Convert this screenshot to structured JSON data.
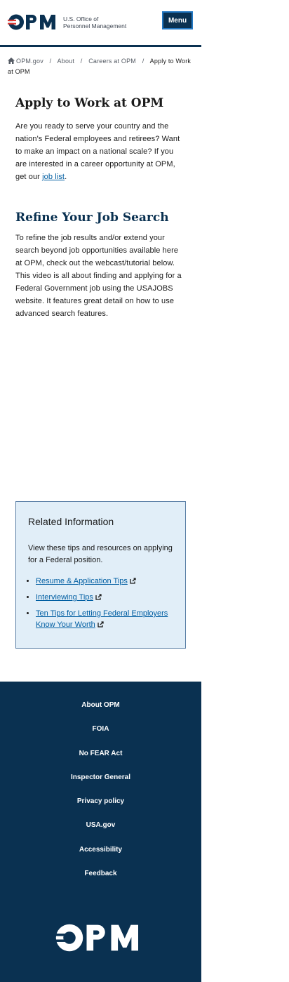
{
  "header": {
    "logo_text": "OPM",
    "agency_line1": "U.S. Office of",
    "agency_line2": "Personnel Management",
    "menu_label": "Menu"
  },
  "breadcrumb": {
    "home": "OPM.gov",
    "items": [
      "About",
      "Careers at OPM"
    ],
    "current": "Apply to Work at OPM"
  },
  "main": {
    "title": "Apply to Work at OPM",
    "intro": "Are you ready to serve your country and the nation's Federal employees and retirees? Want to make an impact on a national scale? If you are interested in a career opportunity at OPM, get our ",
    "intro_link": "job list",
    "intro_end": ".",
    "refine_heading": "Refine Your Job Search",
    "refine_text": "To refine the job results and/or extend your search beyond job opportunities available here at OPM, check out the webcast/tutorial below. This video is all about finding and applying for a Federal Government job using the USAJOBS website. It features great detail on how to use advanced search features."
  },
  "related": {
    "heading": "Related Information",
    "text": "View these tips and resources on applying for a Federal position.",
    "links": [
      "Resume & Application Tips",
      "Interviewing Tips",
      "Ten Tips for Letting Federal Employers Know Your Worth"
    ]
  },
  "footer": {
    "links": [
      "About OPM",
      "FOIA",
      "No FEAR Act",
      "Inspector General",
      "Privacy policy",
      "USA.gov",
      "Accessibility",
      "Feedback"
    ],
    "logo_text": "OPM"
  },
  "colors": {
    "navy": "#0a3151",
    "link": "#005ea2",
    "related_bg": "#e1eef8",
    "logo_red": "#d83933"
  }
}
